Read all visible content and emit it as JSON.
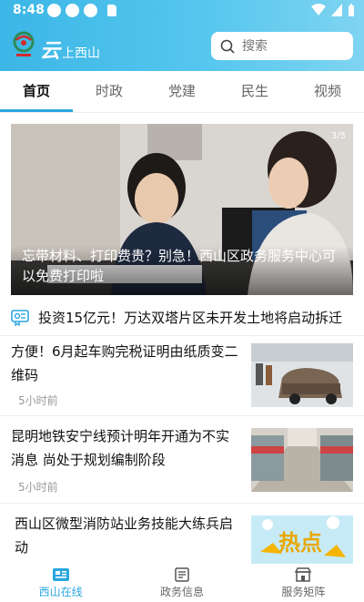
{
  "status": {
    "time": "8:48"
  },
  "header": {
    "brand_main": "云",
    "brand_sub": "上西山",
    "search_placeholder": "搜索"
  },
  "tabs": [
    {
      "label": "首页",
      "active": true
    },
    {
      "label": "时政",
      "active": false
    },
    {
      "label": "党建",
      "active": false
    },
    {
      "label": "民生",
      "active": false
    },
    {
      "label": "视频",
      "active": false
    }
  ],
  "hero": {
    "counter": "3/5",
    "caption": "忘带材料、打印费贵？别急！西山区政务服务中心可以免费打印啦"
  },
  "ticker": {
    "text": "投资15亿元！万达双塔片区未开发土地将启动拆迁"
  },
  "news": [
    {
      "title": "方便！6月起车购完税证明由纸质变二维码",
      "time": "5小时前"
    },
    {
      "title": "昆明地铁安宁线预计明年开通为不实消息 尚处于规划编制阶段",
      "time": "5小时前"
    },
    {
      "title": "西山区微型消防站业务技能大练兵启动",
      "time": "",
      "thumb_text": "热点"
    }
  ],
  "bottom_nav": [
    {
      "label": "西山在线",
      "active": true
    },
    {
      "label": "政务信息",
      "active": false
    },
    {
      "label": "服务矩阵",
      "active": false
    }
  ],
  "colors": {
    "accent": "#2aa7df",
    "header": "#3cb6e6"
  }
}
